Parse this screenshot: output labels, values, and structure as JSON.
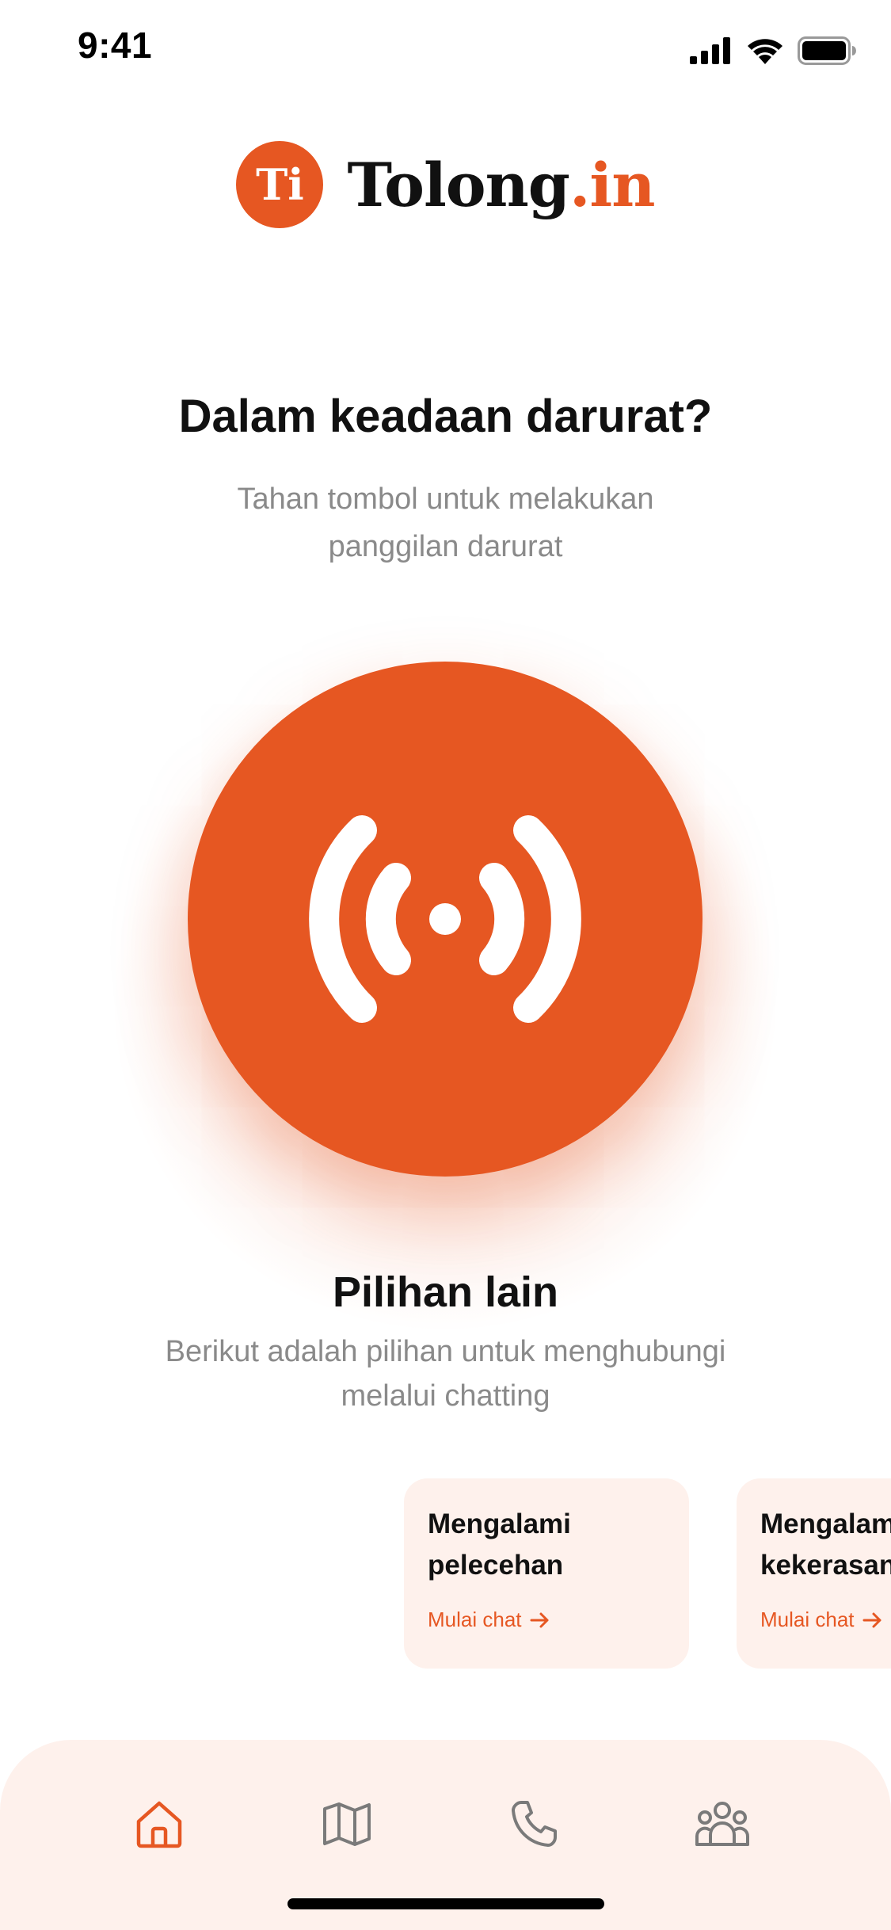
{
  "status_bar": {
    "time": "9:41"
  },
  "logo": {
    "badge": "Ti",
    "name": "Tolong",
    "suffix": ".in"
  },
  "emergency": {
    "title": "Dalam keadaan darurat?",
    "subtitle_line1": "Tahan tombol untuk melakukan",
    "subtitle_line2": "panggilan darurat",
    "button_icon": "broadcast-signal-icon"
  },
  "other_options": {
    "title": "Pilihan lain",
    "subtitle_line1": "Berikut adalah pilihan untuk menghubungi",
    "subtitle_line2": "melalui chatting"
  },
  "cards": [
    {
      "title": "Mengalami\npelecehan",
      "link": "Mulai chat"
    },
    {
      "title": "Mengalami\nkekerasan",
      "link": "Mulai chat"
    }
  ],
  "nav": [
    {
      "icon": "home-icon",
      "active": true
    },
    {
      "icon": "map-icon",
      "active": false
    },
    {
      "icon": "phone-icon",
      "active": false
    },
    {
      "icon": "community-icon",
      "active": false
    }
  ],
  "colors": {
    "accent": "#E65722",
    "card_bg": "#FEF1EC",
    "muted": "#8a8a8a",
    "inactive_icon": "#7a7a7a"
  }
}
